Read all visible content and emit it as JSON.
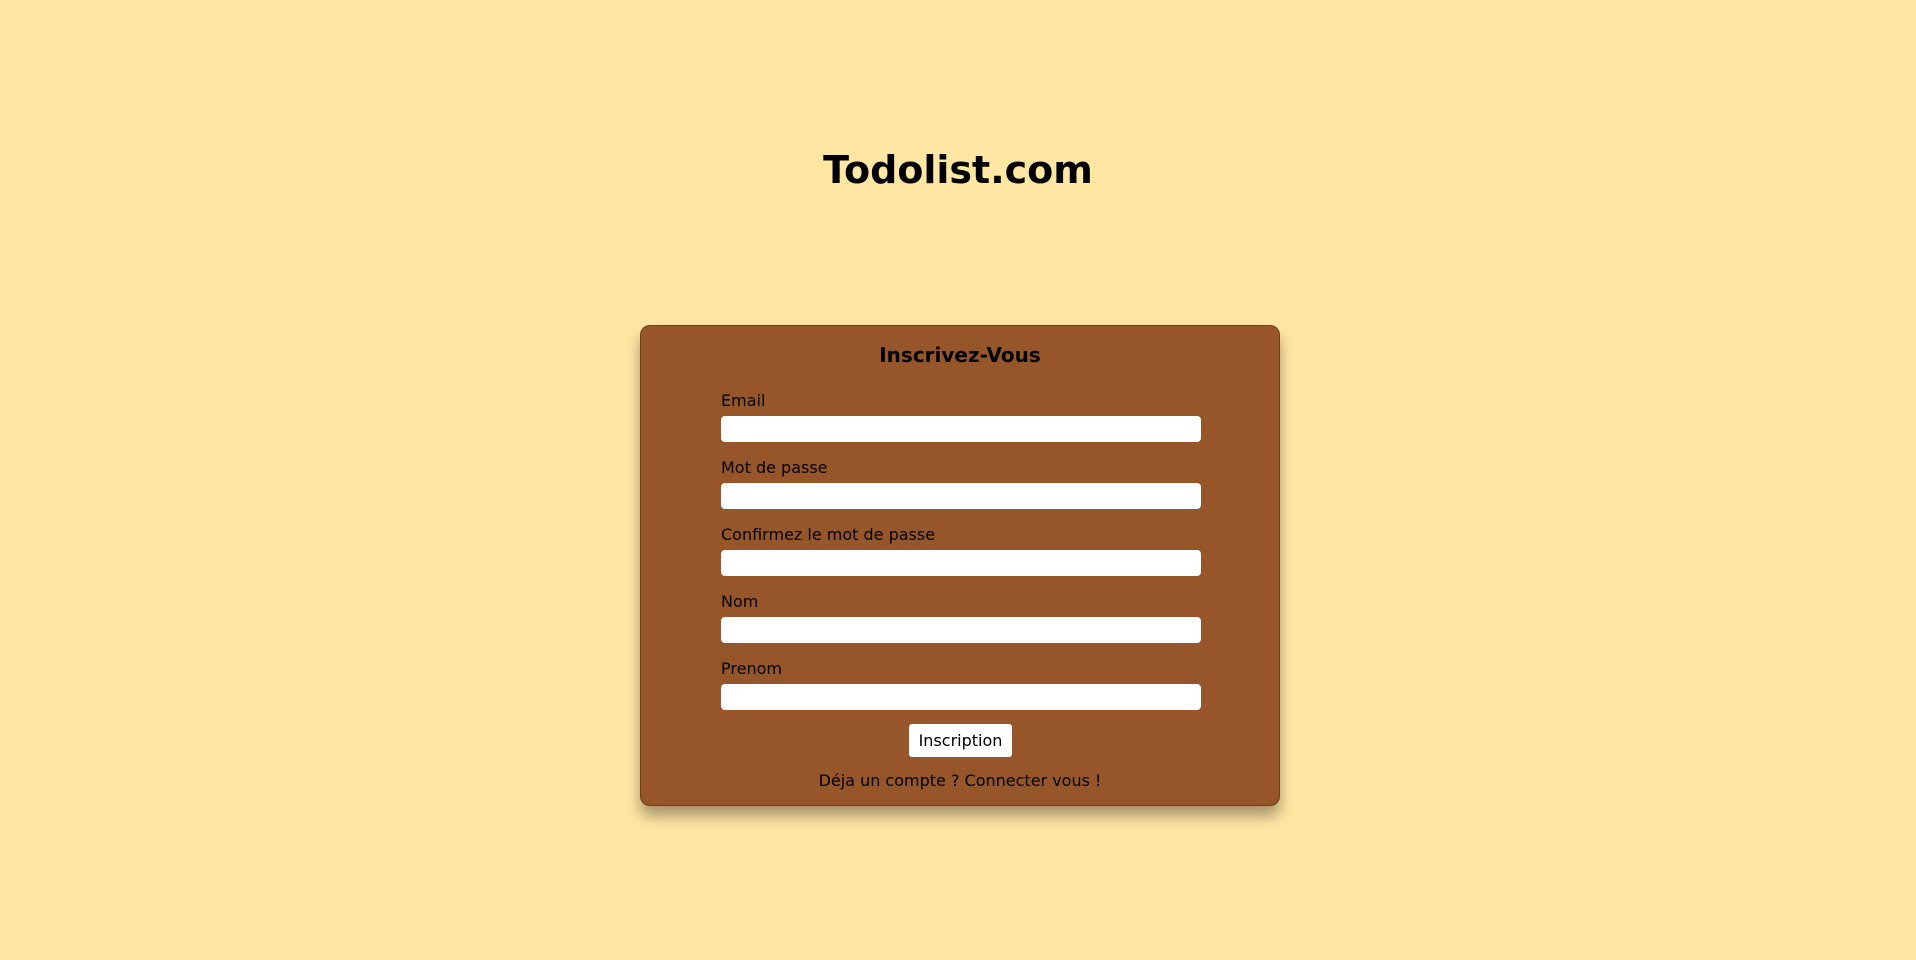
{
  "header": {
    "title": "Todolist.com"
  },
  "form": {
    "title": "Inscrivez-Vous",
    "fields": [
      {
        "label": "Email",
        "value": "",
        "placeholder": ""
      },
      {
        "label": "Mot de passe",
        "value": "",
        "placeholder": ""
      },
      {
        "label": "Confirmez le mot de passe",
        "value": "",
        "placeholder": ""
      },
      {
        "label": "Nom",
        "value": "",
        "placeholder": ""
      },
      {
        "label": "Prenom",
        "value": "",
        "placeholder": ""
      }
    ],
    "submit_label": "Inscription",
    "login_link_text": "Déja un compte ? Connecter vous !"
  },
  "colors": {
    "background": "#ffe6a3",
    "card": "#97562a",
    "input": "#ffffff"
  }
}
